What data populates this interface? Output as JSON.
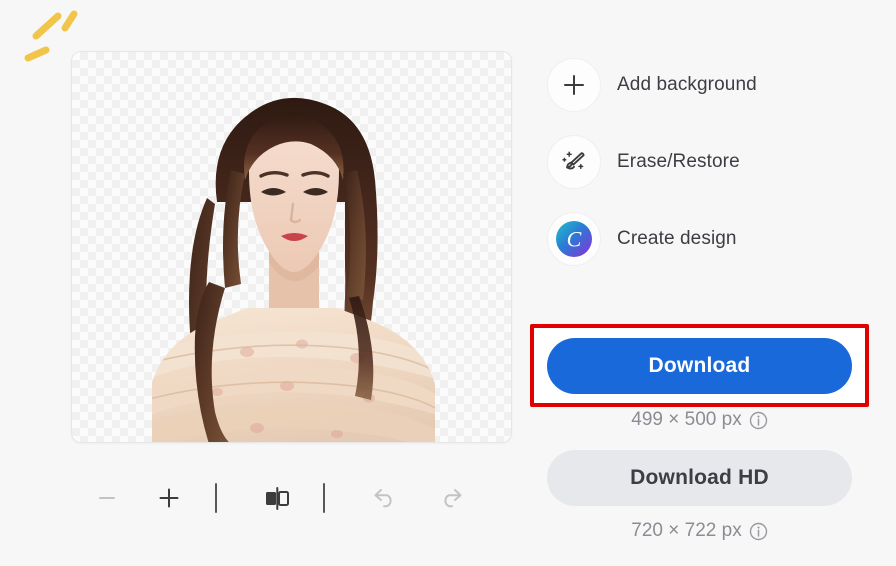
{
  "app": {
    "background_color": "#f7f7f7",
    "decoration": {
      "name": "sparkle-decoration",
      "color": "#f0c54a"
    }
  },
  "canvas": {
    "name": "image-preview-canvas",
    "transparency_checker": true,
    "checker_light": "#fbfbfb",
    "checker_dark": "#f0f0f0",
    "subject_alt": "Woman with long dark brown hair in cream floral off-shoulder ruffled top"
  },
  "toolbar": {
    "items": [
      {
        "name": "zoom-out-button",
        "icon": "minus-icon",
        "enabled": false
      },
      {
        "name": "zoom-in-button",
        "icon": "plus-icon",
        "enabled": true
      },
      {
        "name": "compare-toggle-button",
        "icon": "compare-split-icon",
        "enabled": true
      },
      {
        "name": "undo-button",
        "icon": "undo-arrow-icon",
        "enabled": false
      },
      {
        "name": "redo-button",
        "icon": "redo-arrow-icon",
        "enabled": false
      }
    ]
  },
  "actions": [
    {
      "label": "Add background",
      "icon": "plus-icon"
    },
    {
      "label": "Erase/Restore",
      "icon": "magic-brush-icon"
    },
    {
      "label": "Create design",
      "icon": "canva-logo-icon"
    }
  ],
  "download": {
    "primary_label": "Download",
    "primary_color": "#1a69da",
    "primary_dimensions": "499 × 500 px",
    "hd_label": "Download HD",
    "hd_color": "#e6e8eb",
    "hd_dimensions": "720 × 722 px",
    "info_icon": "info-circle-icon",
    "highlight_color": "#e00000"
  }
}
